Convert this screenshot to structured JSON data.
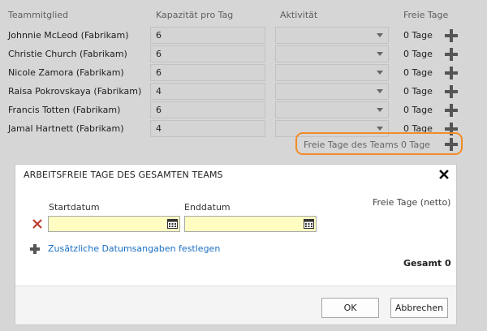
{
  "columns": {
    "member": "Teammitglied",
    "capacity": "Kapazität pro Tag",
    "activity": "Aktivität",
    "days_off": "Freie Tage"
  },
  "members": [
    {
      "name": "Johnnie McLeod (Fabrikam)",
      "capacity": "6",
      "activity": "",
      "days_off": "0 Tage"
    },
    {
      "name": "Christie Church (Fabrikam)",
      "capacity": "6",
      "activity": "",
      "days_off": "0 Tage"
    },
    {
      "name": "Nicole Zamora (Fabrikam)",
      "capacity": "6",
      "activity": "",
      "days_off": "0 Tage"
    },
    {
      "name": "Raisa Pokrovskaya (Fabrikam)",
      "capacity": "4",
      "activity": "",
      "days_off": "0 Tage"
    },
    {
      "name": "Francis Totten (Fabrikam)",
      "capacity": "6",
      "activity": "",
      "days_off": "0 Tage"
    },
    {
      "name": "Jamal Hartnett (Fabrikam)",
      "capacity": "4",
      "activity": "",
      "days_off": "0 Tage"
    }
  ],
  "team_days_off": {
    "label": "Freie Tage des Teams 0 Tage",
    "highlight_color": "#f28c28"
  },
  "dialog": {
    "title": "ARBEITSFREIE TAGE DES GESAMTEN TEAMS",
    "net_days_header": "Freie Tage (netto)",
    "start_label": "Startdatum",
    "end_label": "Enddatum",
    "start_value": "",
    "end_value": "",
    "add_link": "Zusätzliche Datumsangaben festlegen",
    "total": "Gesamt 0",
    "ok": "OK",
    "cancel": "Abbrechen",
    "date_field_color": "#fffdc2",
    "link_color": "#1a6fc4",
    "delete_color": "#c0392b"
  },
  "icons": {
    "add": "plus-icon",
    "close": "close-icon",
    "delete": "delete-x-icon",
    "calendar": "calendar-icon",
    "dropdown": "chevron-down-icon"
  }
}
